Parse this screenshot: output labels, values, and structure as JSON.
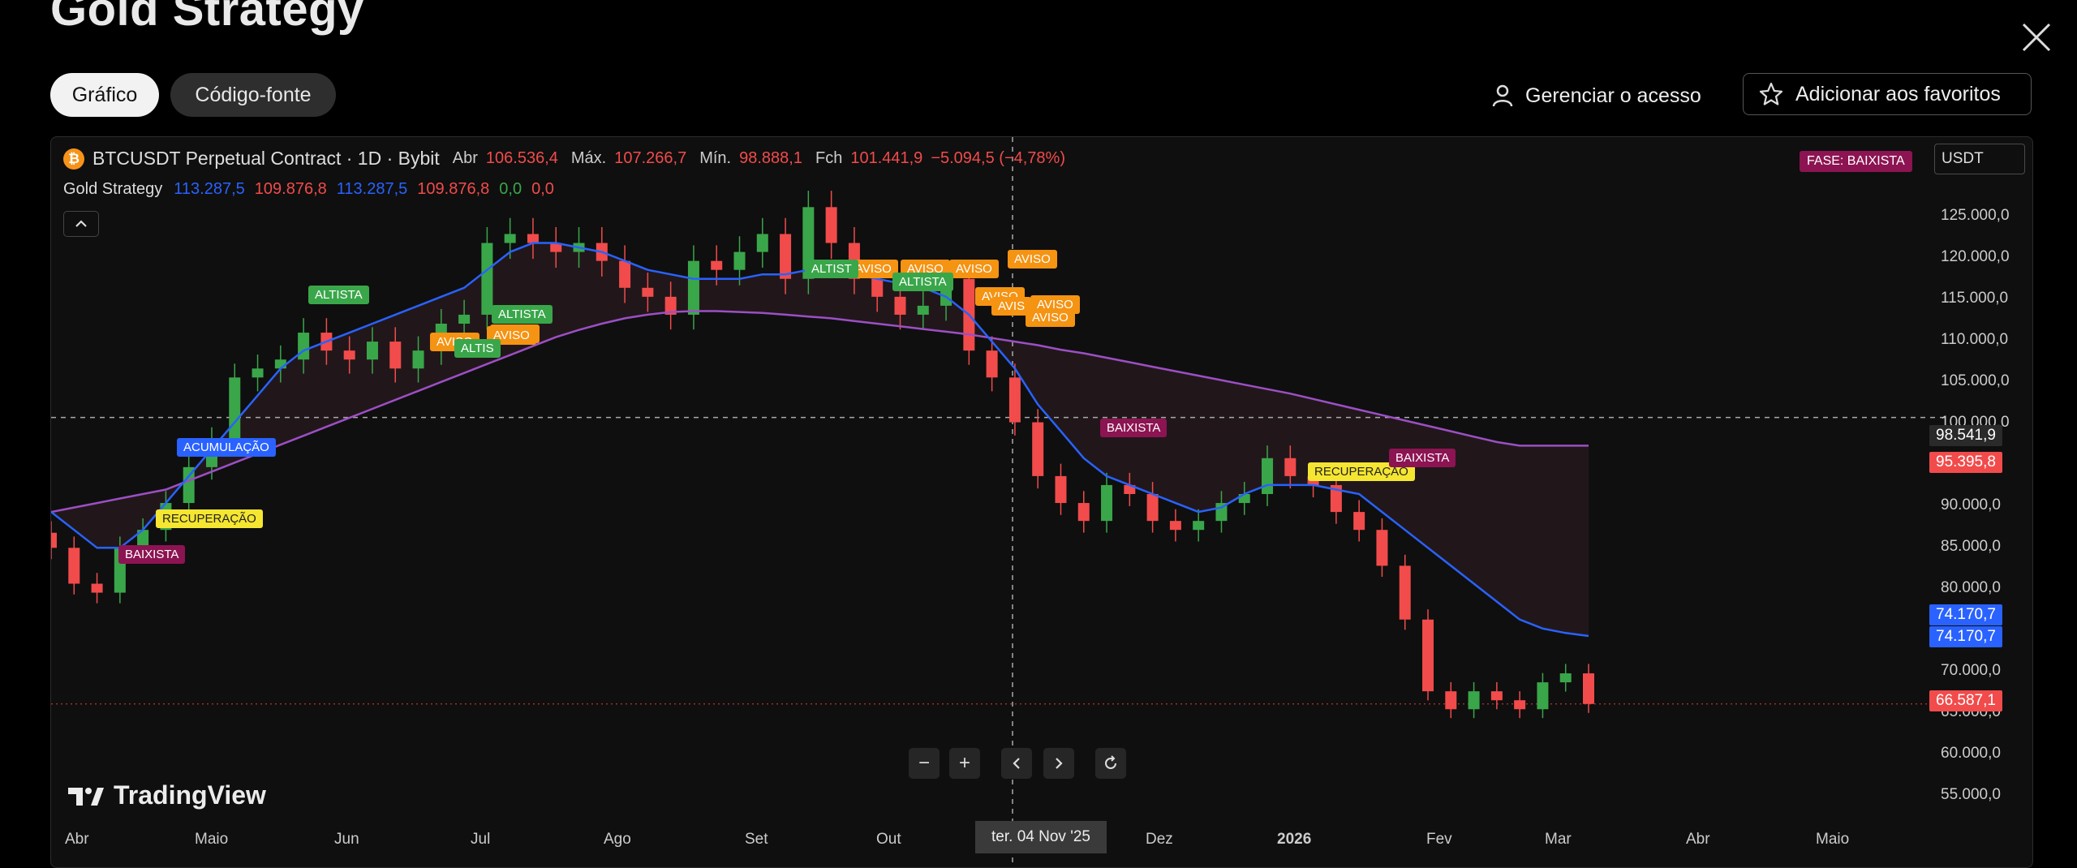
{
  "page": {
    "title": "Gold Strategy"
  },
  "tabs": [
    {
      "label": "Gráfico",
      "active": true
    },
    {
      "label": "Código-fonte",
      "active": false
    }
  ],
  "actions": {
    "manage_access": "Gerenciar o acesso",
    "add_favorites": "Adicionar aos favoritos"
  },
  "symbol": {
    "name": "BTCUSDT Perpetual Contract · 1D · Bybit",
    "open_label": "Abr",
    "open": "106.536,4",
    "high_label": "Máx.",
    "high": "107.266,7",
    "low_label": "Mín.",
    "low": "98.888,1",
    "close_label": "Fch",
    "close": "101.441,9",
    "change": "−5.094,5 (−4,78%)"
  },
  "indicator": {
    "name": "Gold Strategy",
    "values": [
      {
        "v": "113.287,5",
        "color": "#2962ff"
      },
      {
        "v": "109.876,8",
        "color": "#f24b4b"
      },
      {
        "v": "113.287,5",
        "color": "#2962ff"
      },
      {
        "v": "109.876,8",
        "color": "#f24b4b"
      },
      {
        "v": "0,0",
        "color": "#3aa64a"
      },
      {
        "v": "0,0",
        "color": "#f24b4b"
      }
    ]
  },
  "phase_badge": "FASE: BAIXISTA",
  "currency": "USDT",
  "y_axis": [
    "125.000,0",
    "120.000,0",
    "115.000,0",
    "110.000,0",
    "105.000,0",
    "100.000,0",
    "90.000,0",
    "85.000,0",
    "80.000,0",
    "70.000,0",
    "65.000,0",
    "60.000,0",
    "55.000,0"
  ],
  "price_badges": [
    {
      "label": "98.541,9",
      "color": "#2a2a2a"
    },
    {
      "label": "95.395,8",
      "color": "#f24b4b"
    },
    {
      "label": "74.170,7",
      "color": "#2962ff"
    },
    {
      "label": "74.170,7",
      "color": "#2962ff"
    },
    {
      "label": "66.587,1",
      "color": "#f24b4b"
    }
  ],
  "x_axis": [
    "Abr",
    "Maio",
    "Jun",
    "Jul",
    "Ago",
    "Set",
    "Out",
    "Dez",
    "2026",
    "Fev",
    "Mar",
    "Abr",
    "Maio"
  ],
  "crosshair_date": "ter. 04 Nov '25",
  "signals": [
    {
      "label": "ALTISTA",
      "style": "green"
    },
    {
      "label": "AVISO",
      "style": "orange"
    },
    {
      "label": "AVISO",
      "style": "orange"
    },
    {
      "label": "ALTISTA",
      "style": "green"
    },
    {
      "label": "AVISO",
      "style": "orange"
    },
    {
      "label": "ALTIS",
      "style": "green"
    },
    {
      "label": "ALTISTA",
      "style": "green"
    },
    {
      "label": "AVISO",
      "style": "orange"
    },
    {
      "label": "AVISO",
      "style": "orange"
    },
    {
      "label": "ALTIST",
      "style": "green"
    },
    {
      "label": "AVISO",
      "style": "orange"
    },
    {
      "label": "ALTISTA",
      "style": "green"
    },
    {
      "label": "AVISO",
      "style": "orange"
    },
    {
      "label": "AVISO",
      "style": "orange"
    },
    {
      "label": "AVIS",
      "style": "orange"
    },
    {
      "label": "AVISO",
      "style": "orange"
    },
    {
      "label": "AVISO",
      "style": "orange"
    },
    {
      "label": "ACUMULAÇÃO",
      "style": "blue"
    },
    {
      "label": "RECUPERAÇÃO",
      "style": "yellow"
    },
    {
      "label": "BAIXISTA",
      "style": "maroon"
    },
    {
      "label": "BAIXISTA",
      "style": "maroon"
    },
    {
      "label": "RECUPERAÇÃO",
      "style": "yellow"
    },
    {
      "label": "BAIXISTA",
      "style": "maroon"
    }
  ],
  "brand": "TradingView",
  "colors": {
    "up": "#3aa64a",
    "down": "#f24b4b",
    "ma_fast": "#2962ff",
    "ma_slow": "#9c4fc4"
  },
  "chart_data": {
    "type": "candlestick",
    "ylim": [
      52000,
      128000
    ],
    "closes": [
      84000,
      80000,
      79000,
      84000,
      86000,
      89000,
      93000,
      96000,
      103000,
      104000,
      105000,
      108000,
      106000,
      105000,
      107000,
      104000,
      106000,
      109000,
      110000,
      118000,
      119000,
      118000,
      117000,
      118000,
      116000,
      113000,
      112000,
      110000,
      116000,
      115000,
      117000,
      119000,
      114000,
      122000,
      118000,
      114000,
      112000,
      110000,
      111000,
      114000,
      106000,
      103000,
      98000,
      92000,
      89000,
      87000,
      91000,
      90000,
      87000,
      86000,
      87000,
      89000,
      90000,
      94000,
      92000,
      91000,
      88000,
      86000,
      82000,
      76000,
      68000,
      66000,
      68000,
      67000,
      66000,
      69000,
      70000,
      66587
    ],
    "ma_fast": [
      88000,
      86000,
      84000,
      84000,
      86000,
      89000,
      92000,
      95000,
      98000,
      101000,
      104000,
      106000,
      107000,
      108000,
      109000,
      110000,
      111000,
      112000,
      113000,
      115000,
      117000,
      118000,
      118000,
      117500,
      117000,
      116000,
      115000,
      114500,
      114000,
      114000,
      114000,
      114500,
      114500,
      115000,
      115000,
      114500,
      114000,
      113500,
      113000,
      112000,
      110000,
      107000,
      104000,
      100000,
      97000,
      94000,
      92000,
      91000,
      90000,
      89000,
      88000,
      88500,
      90000,
      91000,
      91000,
      91000,
      90500,
      90000,
      88000,
      86000,
      84000,
      82000,
      80000,
      78000,
      76000,
      75000,
      74500,
      74170.7
    ],
    "ma_slow": [
      88000,
      88500,
      89000,
      89500,
      90000,
      90500,
      91500,
      92500,
      93500,
      94500,
      95500,
      96500,
      97500,
      98500,
      99500,
      100500,
      101500,
      102500,
      103500,
      104500,
      105500,
      106500,
      107500,
      108300,
      109000,
      109600,
      110000,
      110300,
      110400,
      110400,
      110300,
      110200,
      110000,
      109800,
      109600,
      109300,
      109000,
      108700,
      108400,
      108100,
      107800,
      107400,
      107000,
      106600,
      106100,
      105700,
      105200,
      104700,
      104200,
      103700,
      103200,
      102700,
      102200,
      101700,
      101200,
      100600,
      100000,
      99400,
      98800,
      98200,
      97600,
      97000,
      96400,
      95800,
      95395.8,
      95395.8,
      95395.8,
      95395.8
    ]
  }
}
